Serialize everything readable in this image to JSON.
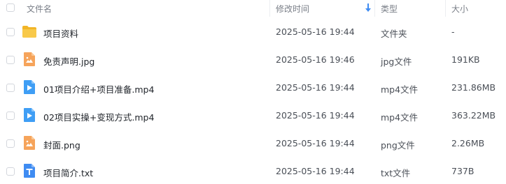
{
  "header": {
    "name_label": "文件名",
    "time_label": "修改时间",
    "type_label": "类型",
    "size_label": "大小",
    "sort_icon": "arrow-down-icon"
  },
  "colors": {
    "folder": "#f7c23a",
    "image": "#f6a45b",
    "video": "#3f9ef5",
    "text": "#3f8cf2"
  },
  "files": [
    {
      "name": "项目资料",
      "time": "2025-05-16 19:44",
      "type": "文件夹",
      "size": "-",
      "icon": "folder-icon"
    },
    {
      "name": "免责声明.jpg",
      "time": "2025-05-16 19:46",
      "type": "jpg文件",
      "size": "191KB",
      "icon": "image-file-icon"
    },
    {
      "name": "01项目介绍+项目准备.mp4",
      "time": "2025-05-16 19:44",
      "type": "mp4文件",
      "size": "231.86MB",
      "icon": "video-file-icon"
    },
    {
      "name": "02项目实操+变现方式.mp4",
      "time": "2025-05-16 19:44",
      "type": "mp4文件",
      "size": "363.22MB",
      "icon": "video-file-icon"
    },
    {
      "name": "封面.png",
      "time": "2025-05-16 19:44",
      "type": "png文件",
      "size": "2.26MB",
      "icon": "image-file-icon"
    },
    {
      "name": "项目简介.txt",
      "time": "2025-05-16 19:44",
      "type": "txt文件",
      "size": "737B",
      "icon": "text-file-icon"
    }
  ]
}
